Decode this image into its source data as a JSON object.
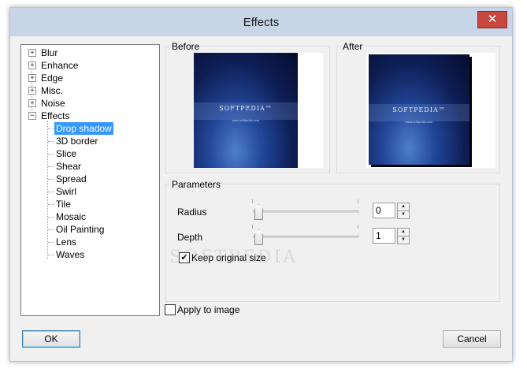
{
  "window": {
    "title": "Effects",
    "close_glyph": "✕"
  },
  "tree": {
    "expand_glyph": "+",
    "collapse_glyph": "−",
    "categories": [
      "Blur",
      "Enhance",
      "Edge",
      "Misc.",
      "Noise",
      "Effects"
    ],
    "effects": [
      "Drop shadow",
      "3D border",
      "Slice",
      "Shear",
      "Spread",
      "Swirl",
      "Tile",
      "Mosaic",
      "Oil Painting",
      "Lens",
      "Waves"
    ],
    "selected": "Drop shadow"
  },
  "preview": {
    "before_label": "Before",
    "after_label": "After",
    "logo_text": "SOFTPEDIA™",
    "url_text": "www.softpedia.com"
  },
  "parameters": {
    "group_label": "Parameters",
    "radius_label": "Radius",
    "radius_value": "0",
    "depth_label": "Depth",
    "depth_value": "1",
    "keep_size_label": "Keep original size",
    "keep_size_checked": true
  },
  "apply_label": "Apply to image",
  "apply_checked": false,
  "buttons": {
    "ok": "OK",
    "cancel": "Cancel"
  },
  "watermark": "SOFTPEDIA",
  "icons": {
    "close": "close-icon",
    "spin_up": "▲",
    "spin_down": "▼",
    "check": "✔"
  },
  "colors": {
    "selection": "#3399ff",
    "close_button": "#c7483f",
    "titlebar": "#c7d5e6"
  }
}
